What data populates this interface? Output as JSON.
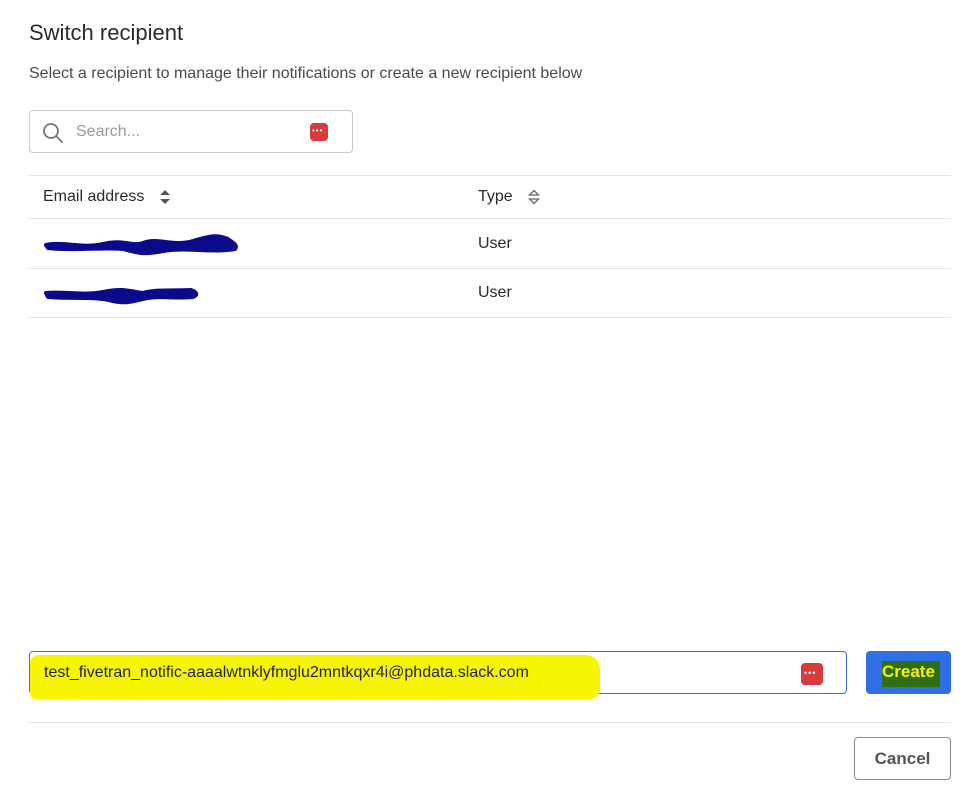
{
  "dialog": {
    "title": "Switch recipient",
    "subtitle": "Select a recipient to manage their notifications or create a new recipient below"
  },
  "search": {
    "placeholder": "Search...",
    "value": ""
  },
  "table": {
    "headers": {
      "email": "Email address",
      "type": "Type"
    },
    "rows": [
      {
        "email": "",
        "type": "User"
      },
      {
        "email": "",
        "type": "User"
      }
    ]
  },
  "create": {
    "input_value": "test_fivetran_notific-aaaalwtnklyfmglu2mntkqxr4i@phdata.slack.com",
    "button_label": "Create"
  },
  "footer": {
    "cancel_label": "Cancel"
  },
  "colors": {
    "primary": "#2e6fe6",
    "highlight": "#f7f500",
    "redaction": "#0a0a8a",
    "password_manager": "#d93a3a"
  },
  "icons": {
    "search": "search-icon",
    "sort": "sort-icon",
    "password_manager": "password-manager-icon"
  }
}
